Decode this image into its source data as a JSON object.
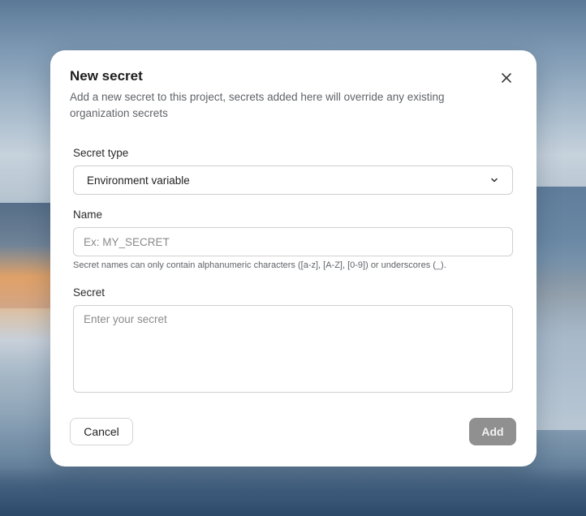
{
  "dialog": {
    "title": "New secret",
    "description": "Add a new secret to this project, secrets added here will override any existing organization secrets",
    "close_icon": "close-icon"
  },
  "fields": {
    "secret_type": {
      "label": "Secret type",
      "selected": "Environment variable",
      "icon": "chevron-down-icon"
    },
    "name": {
      "label": "Name",
      "value": "",
      "placeholder": "Ex: MY_SECRET",
      "hint": "Secret names can only contain alphanumeric characters ([a-z], [A-Z], [0-9]) or underscores (_)."
    },
    "secret": {
      "label": "Secret",
      "value": "",
      "placeholder": "Enter your secret"
    }
  },
  "actions": {
    "cancel_label": "Cancel",
    "add_label": "Add",
    "add_color": "#909090"
  }
}
